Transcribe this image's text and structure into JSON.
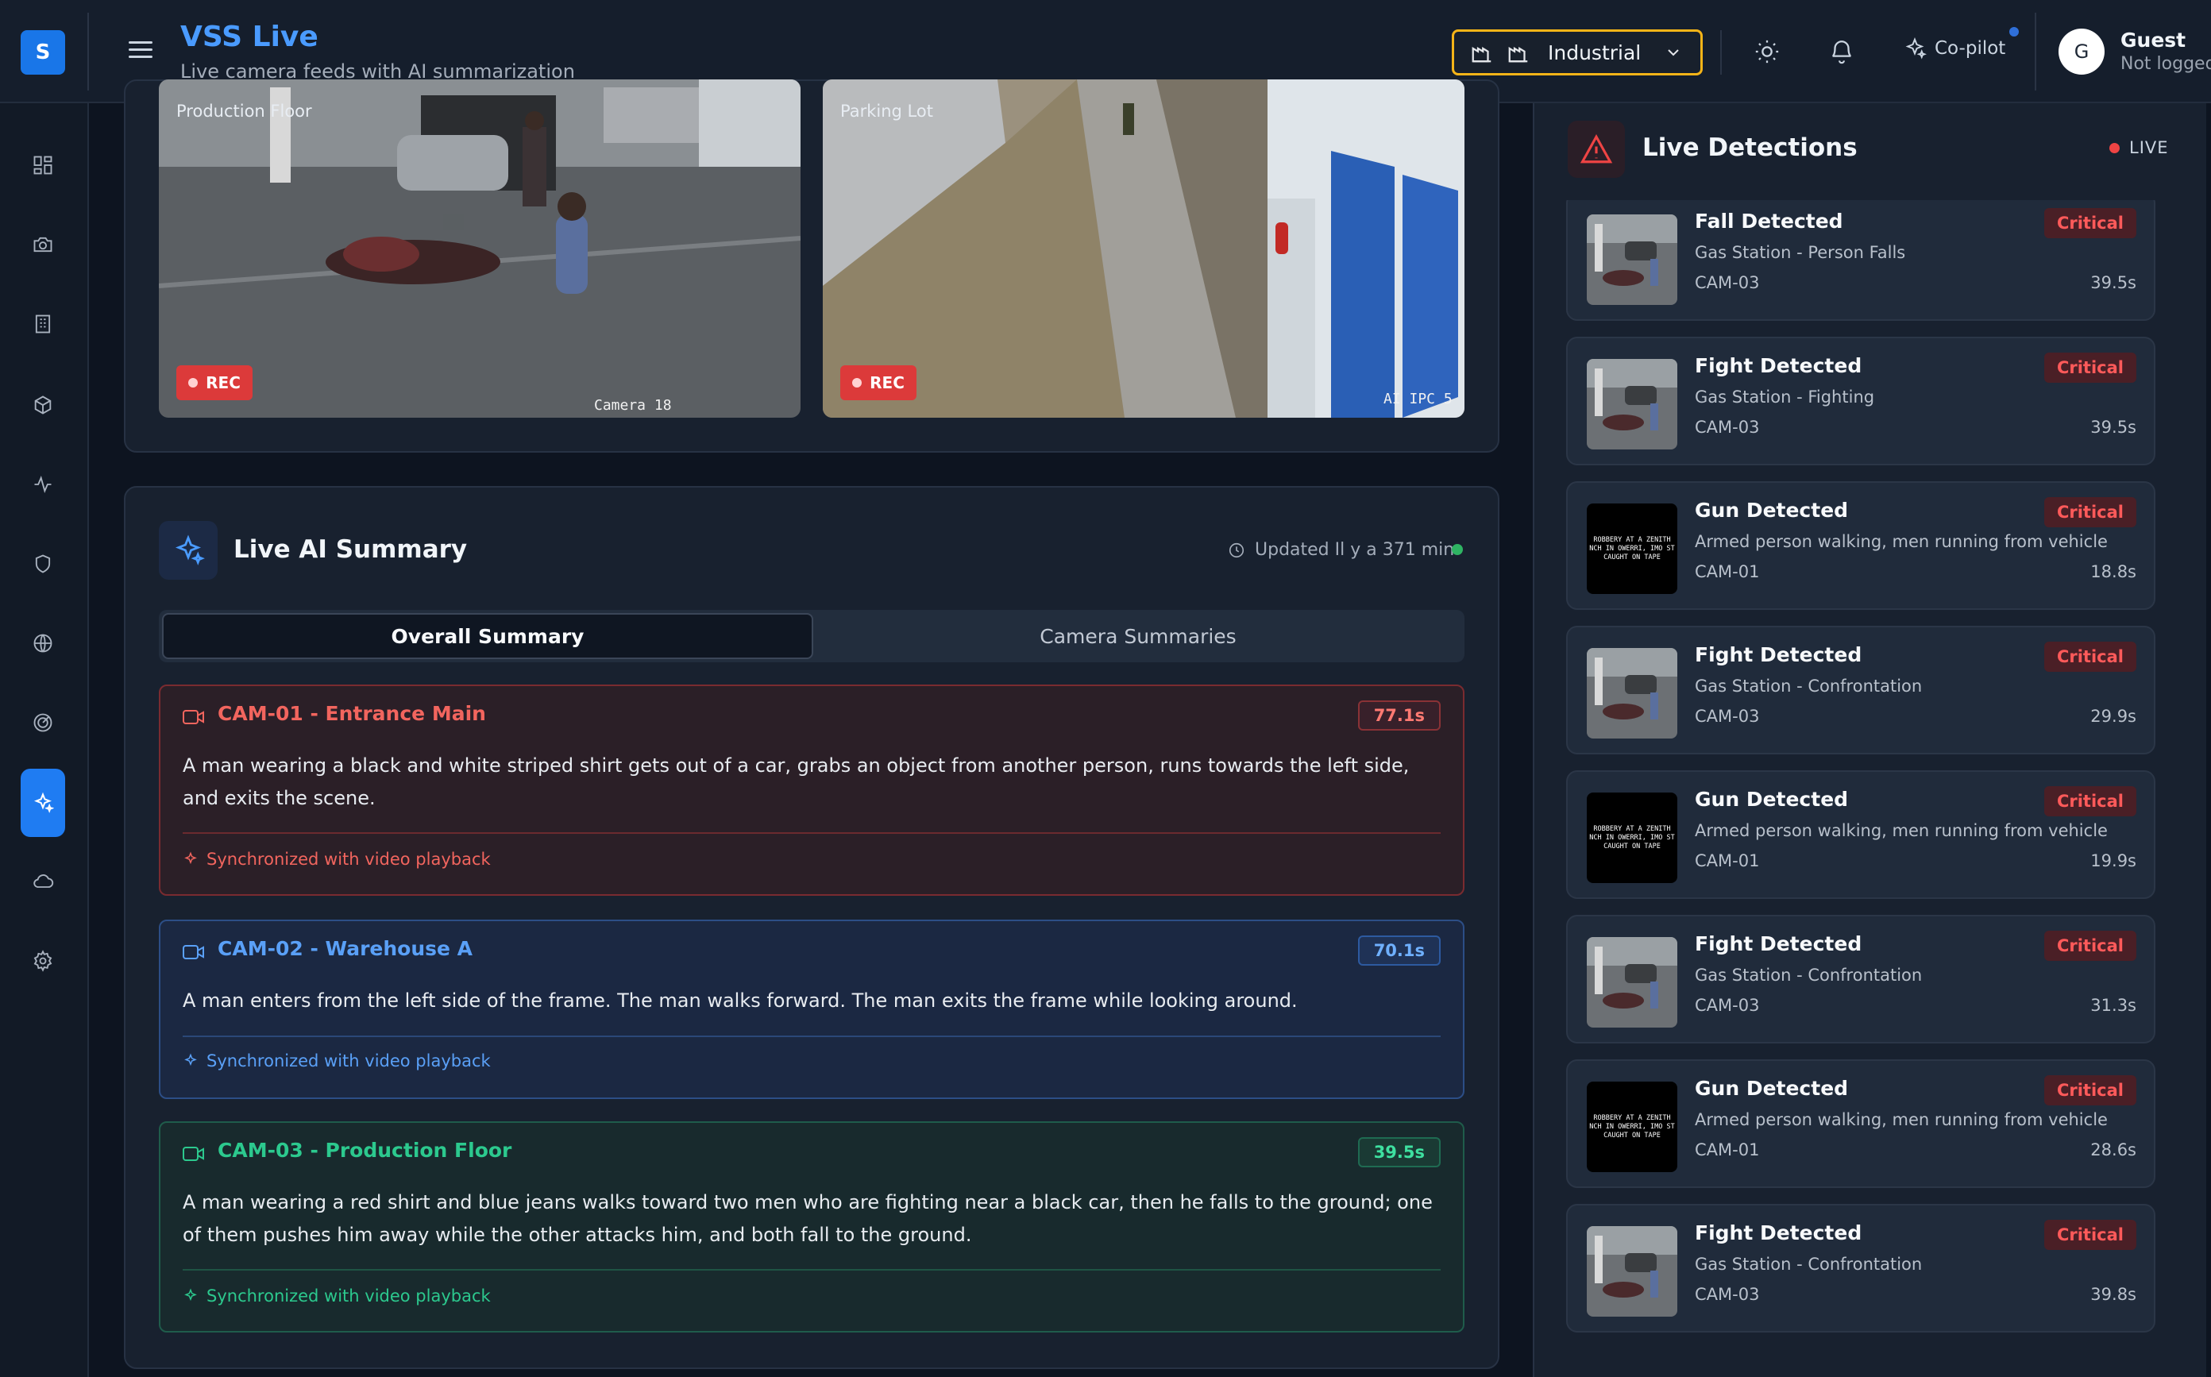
{
  "app": {
    "logo_letter": "S",
    "title": "VSS Live",
    "subtitle": "Live camera feeds with AI summarization"
  },
  "header": {
    "industry": "Industrial",
    "copilot_label": "Co-pilot",
    "user_initial": "G",
    "user_name": "Guest",
    "user_status": "Not logged in"
  },
  "sidebar": {
    "items": [
      {
        "icon": "dashboard-icon"
      },
      {
        "icon": "camera-icon"
      },
      {
        "icon": "building-icon"
      },
      {
        "icon": "package-icon"
      },
      {
        "icon": "activity-icon"
      },
      {
        "icon": "shield-icon"
      },
      {
        "icon": "globe-icon"
      },
      {
        "icon": "radar-icon"
      },
      {
        "icon": "sparkles-icon",
        "active": true
      },
      {
        "icon": "cloud-icon"
      },
      {
        "icon": "settings-icon"
      }
    ]
  },
  "feeds": [
    {
      "label": "Production Floor",
      "rec": "REC",
      "overlay": "Camera 18"
    },
    {
      "label": "Parking Lot",
      "rec": "REC",
      "overlay": "AI IPC 5"
    }
  ],
  "summary": {
    "title": "Live AI Summary",
    "updated": "Updated Il y a 371 min",
    "tabs": [
      "Overall Summary",
      "Camera Summaries"
    ],
    "sync_text": "Synchronized with video playback",
    "cards": [
      {
        "camera": "CAM-01 - Entrance Main",
        "time": "77.1s",
        "text": "A man wearing a black and white striped shirt gets out of a car, grabs an object from another person, runs towards the left side, and exits the scene.",
        "color": "#f2655e"
      },
      {
        "camera": "CAM-02 - Warehouse A",
        "time": "70.1s",
        "text": "A man enters from the left side of the frame. The man walks forward. The man exits the frame while looking around.",
        "color": "#5aa0f7"
      },
      {
        "camera": "CAM-03 - Production Floor",
        "time": "39.5s",
        "text": "A man wearing a red shirt and blue jeans walks toward two men who are fighting near a black car, then he falls to the ground; one of them pushes him away while the other attacks him, and both fall to the ground.",
        "color": "#2cc98e"
      }
    ]
  },
  "detections": {
    "title": "Live Detections",
    "live_label": "LIVE",
    "items": [
      {
        "name": "Fall Detected",
        "severity": "Critical",
        "desc": "Gas Station - Person Falls",
        "camera": "CAM-03",
        "time": "39.5s",
        "thumb": "station"
      },
      {
        "name": "Fight Detected",
        "severity": "Critical",
        "desc": "Gas Station - Fighting",
        "camera": "CAM-03",
        "time": "39.5s",
        "thumb": "station"
      },
      {
        "name": "Gun Detected",
        "severity": "Critical",
        "desc": "Armed person walking, men running from vehicle",
        "camera": "CAM-01",
        "time": "18.8s",
        "thumb": "text"
      },
      {
        "name": "Fight Detected",
        "severity": "Critical",
        "desc": "Gas Station - Confrontation",
        "camera": "CAM-03",
        "time": "29.9s",
        "thumb": "station"
      },
      {
        "name": "Gun Detected",
        "severity": "Critical",
        "desc": "Armed person walking, men running from vehicle",
        "camera": "CAM-01",
        "time": "19.9s",
        "thumb": "text"
      },
      {
        "name": "Fight Detected",
        "severity": "Critical",
        "desc": "Gas Station - Confrontation",
        "camera": "CAM-03",
        "time": "31.3s",
        "thumb": "station"
      },
      {
        "name": "Gun Detected",
        "severity": "Critical",
        "desc": "Armed person walking, men running from vehicle",
        "camera": "CAM-01",
        "time": "28.6s",
        "thumb": "text"
      },
      {
        "name": "Fight Detected",
        "severity": "Critical",
        "desc": "Gas Station - Confrontation",
        "camera": "CAM-03",
        "time": "39.8s",
        "thumb": "station"
      }
    ],
    "thumb_caption": [
      "ROBBERY AT A ZENITH",
      "NCH IN OWERRI, IMO ST",
      "CAUGHT ON TAPE"
    ]
  }
}
